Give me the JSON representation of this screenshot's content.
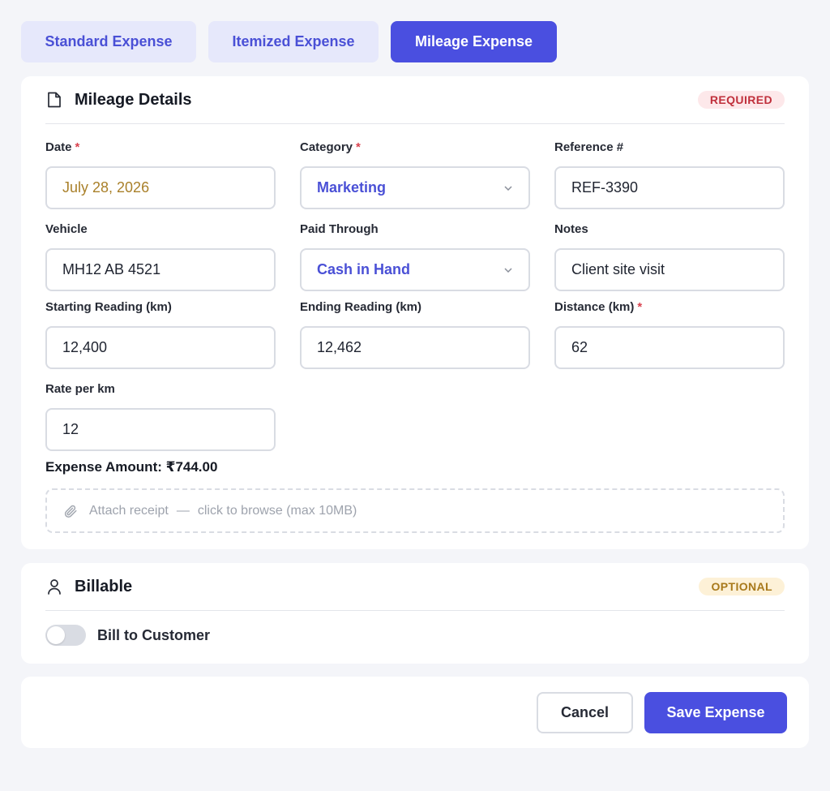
{
  "tabs": [
    {
      "label": "Standard Expense",
      "active": false
    },
    {
      "label": "Itemized Expense",
      "active": false
    },
    {
      "label": "Mileage Expense",
      "active": true
    }
  ],
  "mileage": {
    "title": "Mileage Details",
    "badge": "REQUIRED",
    "title_icon": "document-icon",
    "fields": {
      "date": {
        "label": "Date",
        "required": "*",
        "value": "July 28, 2026"
      },
      "category": {
        "label": "Category",
        "required": "*",
        "value": "Marketing"
      },
      "reference": {
        "label": "Reference #",
        "value": "REF-3390"
      },
      "vehicle": {
        "label": "Vehicle",
        "value": "MH12 AB 4521"
      },
      "paid_through": {
        "label": "Paid Through",
        "value": "Cash in Hand"
      },
      "notes": {
        "label": "Notes",
        "value": "Client site visit"
      },
      "starting_reading": {
        "label": "Starting Reading (km)",
        "value": "12,400"
      },
      "ending_reading": {
        "label": "Ending Reading (km)",
        "value": "12,462"
      },
      "distance": {
        "label": "Distance (km)",
        "required": "*",
        "value": "62"
      },
      "rate": {
        "label": "Rate per km",
        "value": "12"
      }
    },
    "expense_amount": "Expense Amount: ₹744.00",
    "attach": {
      "label": "Attach receipt",
      "separator": "—",
      "hint": "click to browse (max 10MB)"
    }
  },
  "billable": {
    "title": "Billable",
    "badge": "OPTIONAL",
    "title_icon": "user-icon",
    "toggle_label": "Bill to Customer",
    "toggle_on": false
  },
  "actions": {
    "cancel": "Cancel",
    "save": "Save Expense"
  },
  "colors": {
    "accent": "#4a4fe0",
    "required_badge_bg": "#fde8ea",
    "required_badge_text": "#c0303c",
    "optional_badge_bg": "#fdf1d7",
    "optional_badge_text": "#a8791b",
    "date_text": "#a9802a"
  }
}
